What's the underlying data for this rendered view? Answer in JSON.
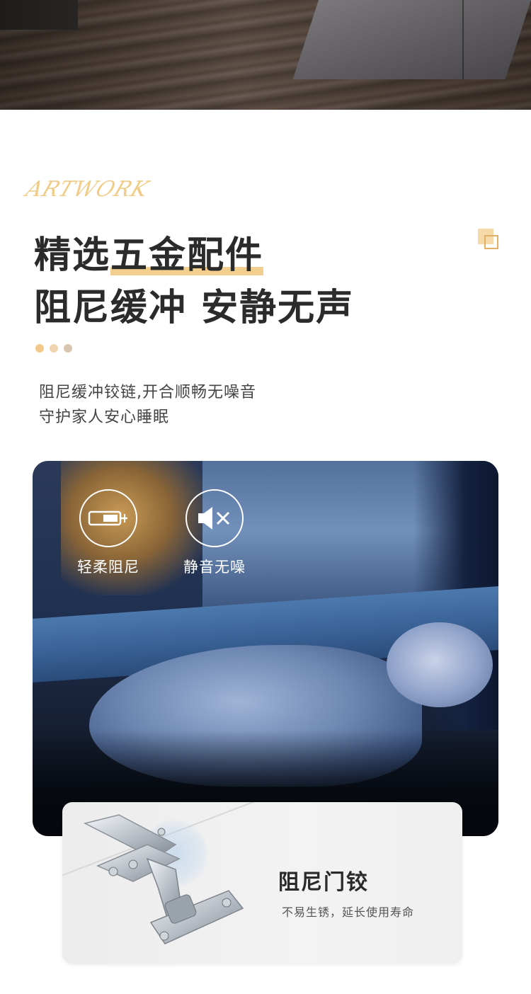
{
  "header": {
    "script_word": "ARTWORK",
    "title_line1_plain": "精选",
    "title_line1_highlight": "五金配件",
    "title_line2": "阻尼缓冲 安静无声",
    "dots_colors": [
      "#f2c98a",
      "#f0d6b0",
      "#d9c6b1"
    ],
    "description_line1": "阻尼缓冲铰链,开合顺畅无噪音",
    "description_line2": "守护家人安心睡眠"
  },
  "features": [
    {
      "label": "轻柔阻尼",
      "icon": "soft-damping-icon"
    },
    {
      "label": "静音无噪",
      "icon": "mute-speaker-icon"
    }
  ],
  "hinge": {
    "title": "阻尼门铰",
    "subtitle": "不易生锈，延长使用寿命"
  },
  "colors": {
    "accent": "#f2cf8f",
    "title": "#2b2b2b",
    "body_text": "#444444"
  }
}
